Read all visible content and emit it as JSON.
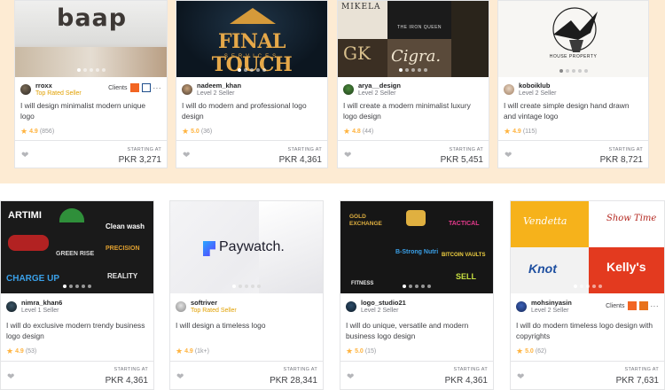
{
  "cards": [
    {
      "seller": "rroxx",
      "level": "Top Rated Seller",
      "clients_label": "Clients",
      "title": "I will design minimalist modern unique logo",
      "rating": "4.9",
      "count": "(856)",
      "starting": "STARTING AT",
      "price": "PKR 3,271",
      "thumb_text": "baap"
    },
    {
      "seller": "nadeem_khan",
      "level": "Level 2 Seller",
      "title": "I will do modern and professional logo design",
      "rating": "5.0",
      "count": "(36)",
      "starting": "STARTING AT",
      "price": "PKR 4,361",
      "thumb_text": "FINAL TOUCH",
      "thumb_sub": "SERVICES"
    },
    {
      "seller": "arya__design",
      "level": "Level 2 Seller",
      "title": "I will create a modern minimalist luxury logo design",
      "rating": "4.8",
      "count": "(44)",
      "starting": "STARTING AT",
      "price": "PKR 5,451",
      "thumb_words": [
        "MIKELA",
        "THE IRON QUEEN",
        "GK",
        "Cigra."
      ]
    },
    {
      "seller": "koboiklub",
      "level": "Level 2 Seller",
      "title": "I will create simple design hand drawn and vintage logo",
      "rating": "4.9",
      "count": "(115)",
      "starting": "STARTING AT",
      "price": "PKR 8,721",
      "thumb_text": "HOUSE PROPERTY"
    },
    {
      "seller": "nimra_khan6",
      "level": "Level 1 Seller",
      "title": "I will do exclusive modern trendy business logo design",
      "rating": "4.9",
      "count": "(53)",
      "starting": "STARTING AT",
      "price": "PKR 4,361",
      "thumb_words": [
        "ARTIMI",
        "Clean wash",
        "PRECISION",
        "GREEN RISE",
        "CHARGE UP",
        "REALITY"
      ]
    },
    {
      "seller": "softriver",
      "level": "Top Rated Seller",
      "title": "I will design a timeless logo",
      "rating": "4.9",
      "count": "(1k+)",
      "starting": "STARTING AT",
      "price": "PKR 28,341",
      "thumb_text": "Paywatch."
    },
    {
      "seller": "logo_studio21",
      "level": "Level 2 Seller",
      "title": "I will do unique, versatile and modern business logo design",
      "rating": "5.0",
      "count": "(15)",
      "starting": "STARTING AT",
      "price": "PKR 4,361",
      "thumb_words": [
        "GOLD EXCHANGE",
        "TACTICAL",
        "B-Strong Nutri",
        "BITCOIN VAULTS",
        "FITNESS",
        "SELL"
      ]
    },
    {
      "seller": "mohsinyasin",
      "level": "Level 2 Seller",
      "clients_label": "Clients",
      "title": "I will do modern timeless logo design with copyrights",
      "rating": "5.0",
      "count": "(62)",
      "starting": "STARTING AT",
      "price": "PKR 7,631",
      "thumb_words": [
        "Vendetta",
        "Show Time",
        "Knot",
        "Kelly's"
      ]
    }
  ],
  "icons": {
    "heart": "heart-icon",
    "star": "star-icon",
    "more": "more-options-icon"
  },
  "colors": {
    "band": "#fdebd3",
    "star": "#ffb33e",
    "top_rated": "#e1a000",
    "text": "#404145"
  }
}
